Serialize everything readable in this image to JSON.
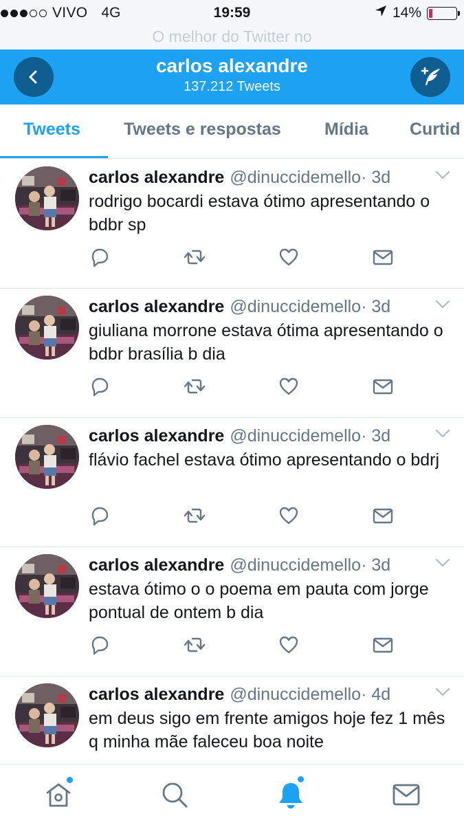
{
  "status_bar": {
    "carrier": "VIVO",
    "network": "4G",
    "time": "19:59",
    "battery": "14%",
    "battery_level": 0.14,
    "signal_bars_filled": 3,
    "signal_bars_total": 5
  },
  "top_banner": "O melhor do Twitter no",
  "header": {
    "name": "carlos alexandre",
    "tweet_count": "137.212 Tweets",
    "back_icon": "back-chevron-icon",
    "compose_icon": "compose-tweet-icon"
  },
  "tabs": [
    {
      "label": "Tweets",
      "active": true
    },
    {
      "label": "Tweets e respostas",
      "active": false
    },
    {
      "label": "Mídia",
      "active": false
    },
    {
      "label": "Curtid",
      "active": false
    }
  ],
  "tweets": [
    {
      "name": "carlos alexandre",
      "handle": "@dinuccidemello",
      "time": "· 3d",
      "text": "rodrigo bocardi estava ótimo apresentando o bdbr sp"
    },
    {
      "name": "carlos alexandre",
      "handle": "@dinuccidemello",
      "time": "· 3d",
      "text": "giuliana morrone estava ótima apresentando o bdbr brasília b dia"
    },
    {
      "name": "carlos alexandre",
      "handle": "@dinuccidemello",
      "time": "· 3d",
      "text": "flávio fachel estava ótimo apresentando o bdrj"
    },
    {
      "name": "carlos alexandre",
      "handle": "@dinuccidemello",
      "time": "· 3d",
      "text": "estava ótimo o o poema em  pauta com jorge pontual de ontem b dia"
    },
    {
      "name": "carlos alexandre",
      "handle": "@dinuccidemello",
      "time": "· 4d",
      "text": "em deus sigo em frente amigos hoje fez 1 mês q minha mãe faleceu boa noite"
    }
  ],
  "bottom_nav": [
    "home-icon",
    "search-icon",
    "notifications-icon",
    "messages-icon"
  ],
  "colors": {
    "accent": "#1da1f2",
    "header_button": "#0f5e91",
    "secondary_text": "#657786",
    "battery_low": "#e0245e"
  }
}
